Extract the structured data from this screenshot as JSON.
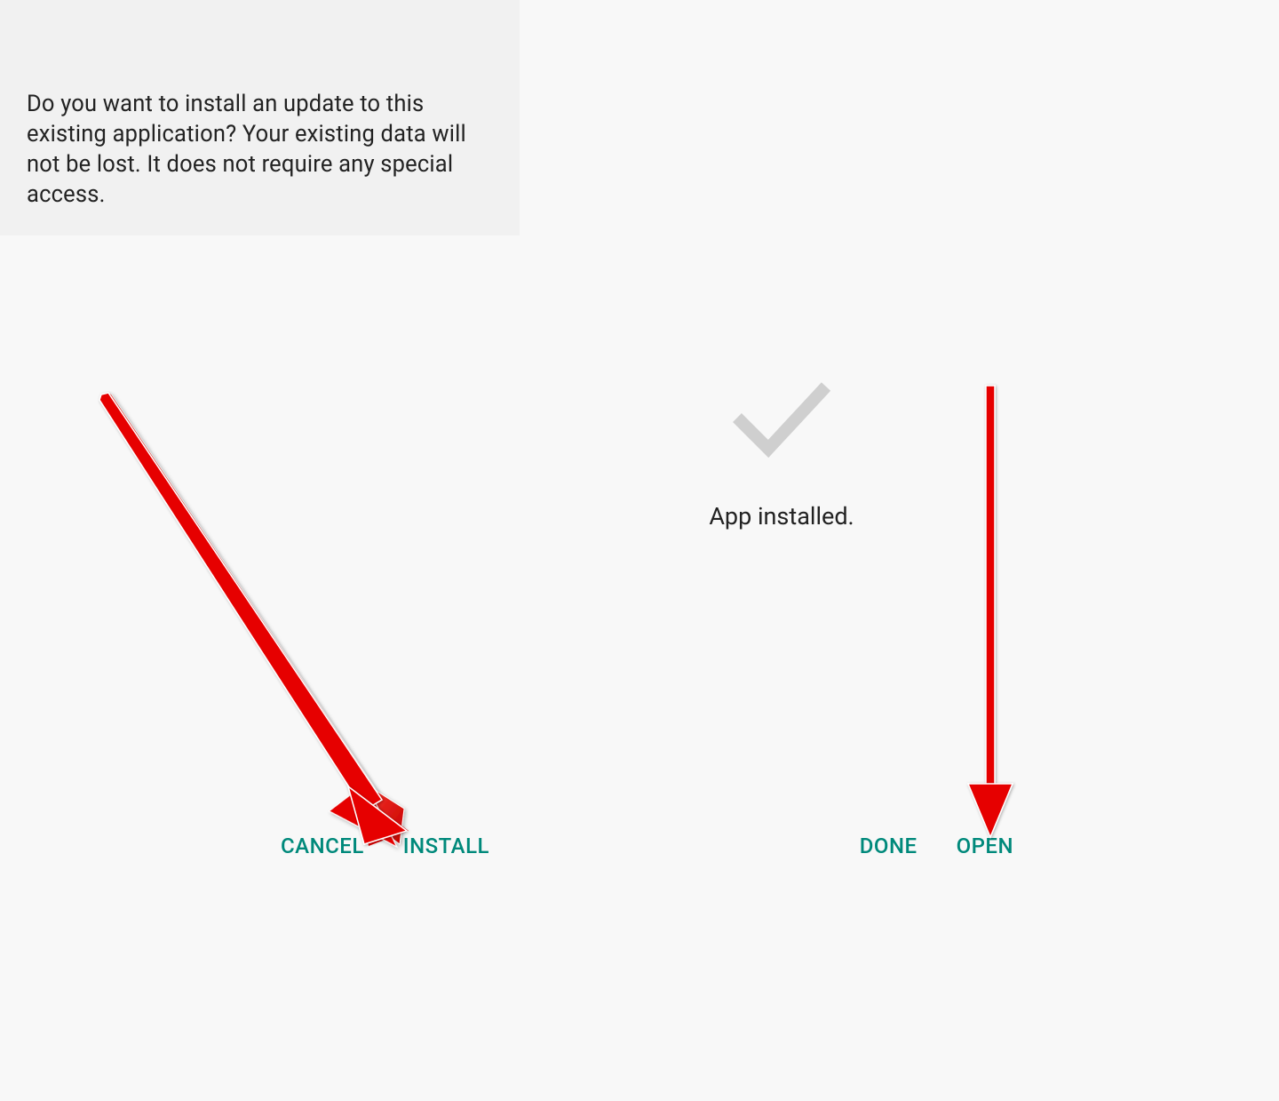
{
  "left_panel": {
    "prompt": "Do you want to install an update to this existing application? Your existing data will not be lost. It does not require any special access.",
    "cancel_label": "CANCEL",
    "install_label": "INSTALL"
  },
  "right_panel": {
    "installed_text": "App installed.",
    "done_label": "DONE",
    "open_label": "OPEN"
  },
  "colors": {
    "accent": "#00897b",
    "arrow": "#e60000"
  }
}
